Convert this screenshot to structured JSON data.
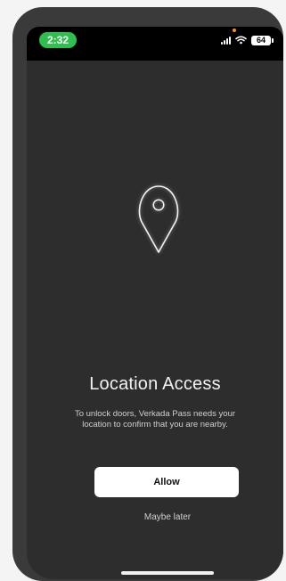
{
  "status_bar": {
    "time": "2:32",
    "battery": "64"
  },
  "icons": {
    "pin": "location-pin-icon",
    "signal": "cellular-signal-icon",
    "wifi": "wifi-icon",
    "battery": "battery-icon"
  },
  "content": {
    "title": "Location Access",
    "description": "To unlock doors, Verkada Pass needs your location to confirm that you are nearby.",
    "allow_label": "Allow",
    "maybe_later_label": "Maybe later"
  },
  "colors": {
    "background": "#2d2d2d",
    "time_pill": "#2fbf4f",
    "button": "#ffffff"
  }
}
